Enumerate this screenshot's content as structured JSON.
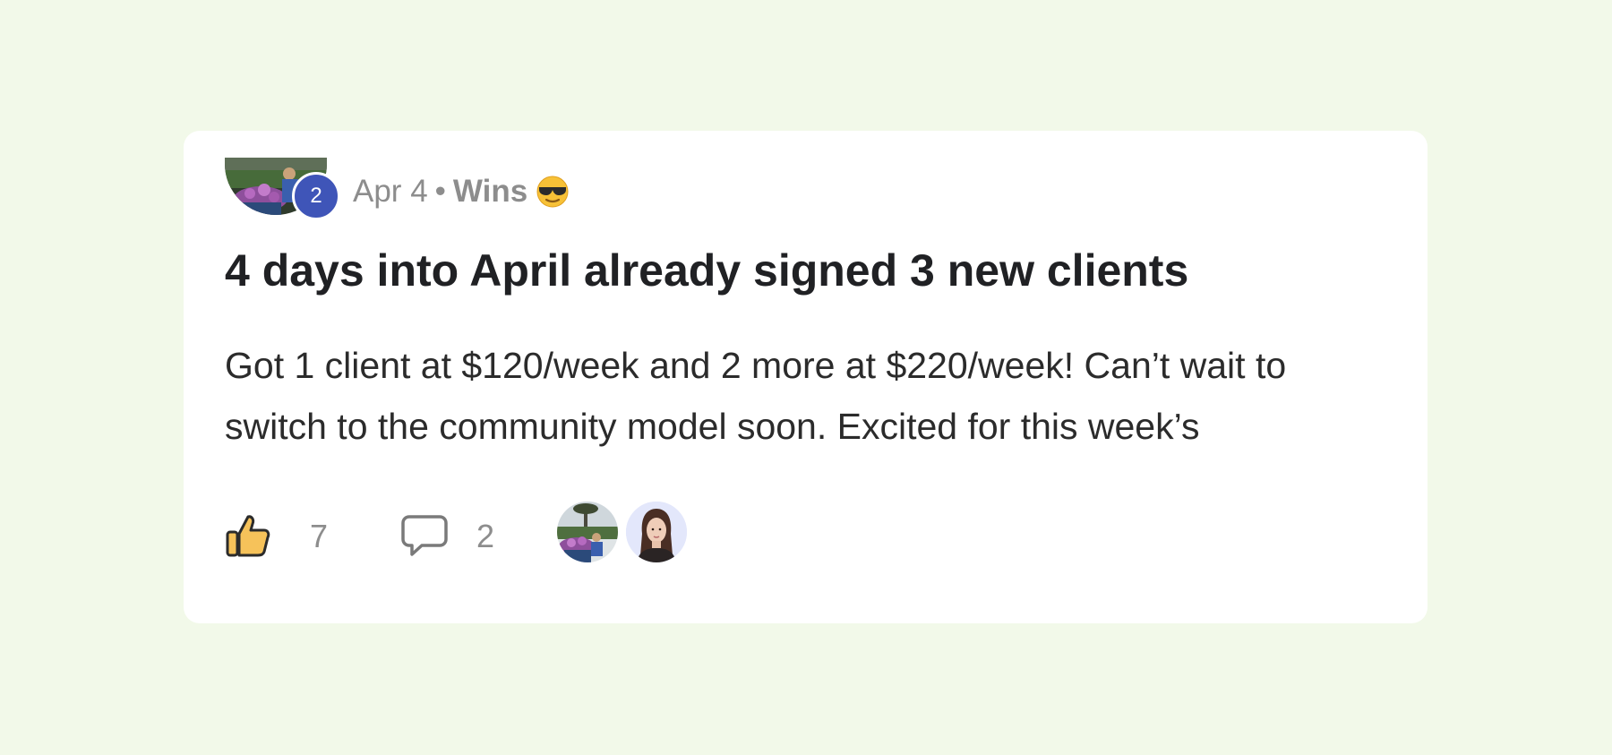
{
  "post": {
    "author_level": "2",
    "date": "Apr 4",
    "separator": "•",
    "category": "Wins",
    "category_emoji": "sunglasses-emoji",
    "title": "4 days into April already signed 3 new clients",
    "body": "Got 1 client at $120/week and 2 more at $220/week! Can’t wait to switch to the community model soon. Excited for this week’s",
    "like_count": "7",
    "comment_count": "2",
    "commenters_shown": 2
  },
  "icons": {
    "like": "thumbs-up-icon",
    "comment": "speech-bubble-icon"
  },
  "colors": {
    "page_background": "#f2f9e9",
    "card_background": "#ffffff",
    "level_badge": "#3f55b8",
    "meta_text": "#8d8d8d",
    "title_text": "#202124",
    "like_fill": "#f6c25a"
  }
}
